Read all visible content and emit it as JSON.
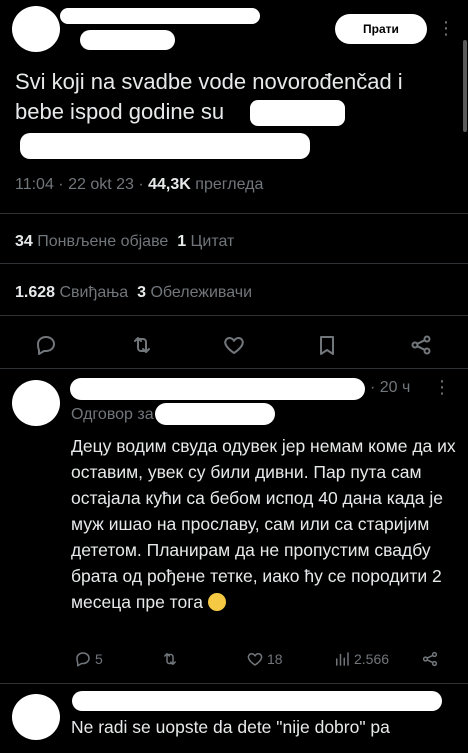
{
  "post": {
    "more_label": "Прати",
    "text": "Svi koji na svadbe vode novorođenčad i bebe ispod godine su",
    "time": "11:04",
    "date": "22 okt 23",
    "views_count": "44,3K",
    "views_label": "прегледа",
    "reposts_count": "34",
    "reposts_label": "Понвљене објаве",
    "quotes_count": "1",
    "quotes_label": "Цитат",
    "likes_count": "1.628",
    "likes_label": "Свиђања",
    "bookmarks_count": "3",
    "bookmarks_label": "Обележивачи"
  },
  "reply": {
    "time": "· 20 ч",
    "reply_to_label": "Одговор за",
    "text": "Децу водим свуда одувек јер немам коме да их оставим, увек су били дивни. Пар пута сам остајала кући са бебом испод 40 дана када је муж ишао на прославу, сам или са старијим дететом. Планирам да не пропустим свадбу брата од рођене тетке, иако ћу се породити 2 месеца пре тога",
    "replies": "5",
    "likes": "18",
    "views": "2.566"
  },
  "reply2": {
    "text": "Ne radi se uopste da dete \"nije dobro\" pa"
  }
}
